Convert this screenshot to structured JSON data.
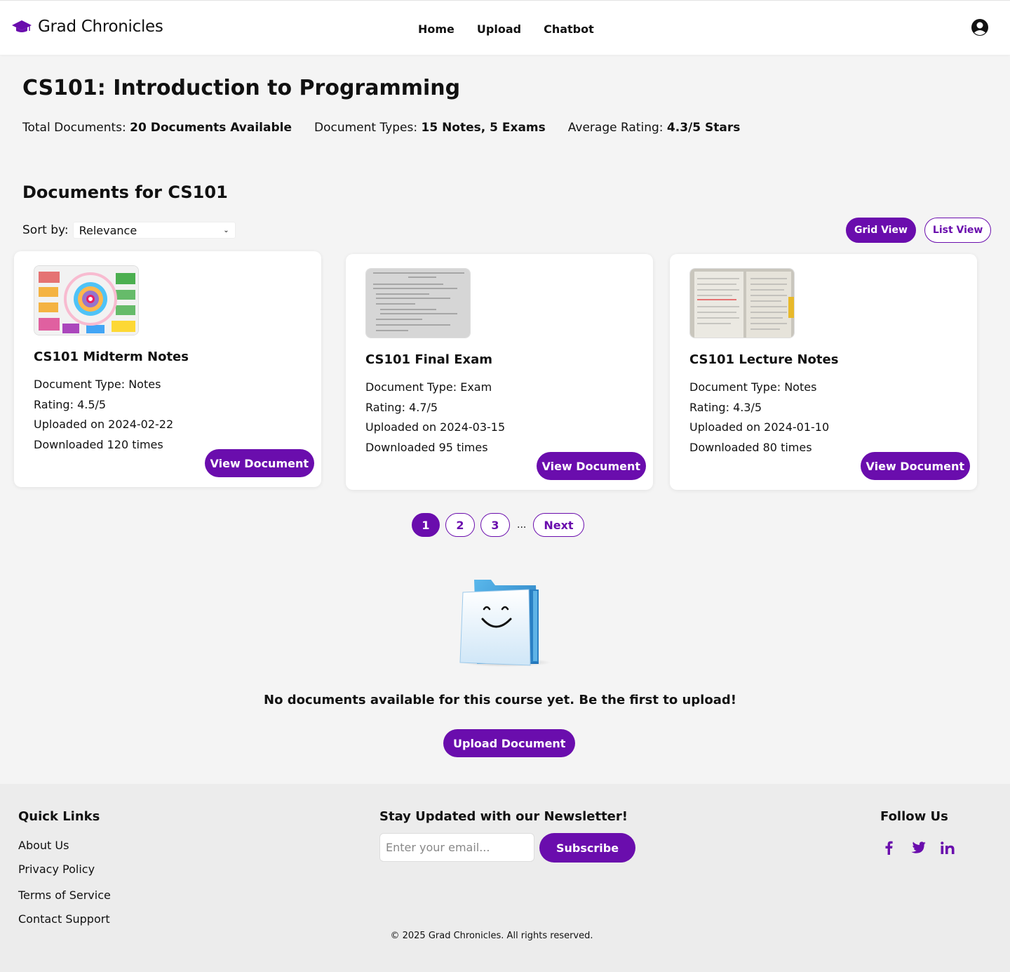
{
  "header": {
    "brand": "Grad Chronicles",
    "brand_icon": "graduation-cap-icon",
    "nav": [
      "Home",
      "Upload",
      "Chatbot"
    ],
    "account_icon": "user-circle-icon"
  },
  "course": {
    "title": "CS101: Introduction to Programming",
    "stats": [
      {
        "label": "Total Documents: ",
        "value": "20 Documents Available"
      },
      {
        "label": "Document Types: ",
        "value": "15 Notes, 5 Exams"
      },
      {
        "label": "Average Rating: ",
        "value": "4.3/5 Stars"
      }
    ]
  },
  "documents": {
    "heading": "Documents for CS101",
    "sort_label": "Sort by:",
    "sort_value": "Relevance",
    "grid_view_label": "Grid View",
    "list_view_label": "List View",
    "cards": [
      {
        "title": "CS101 Midterm Notes",
        "type": "Document Type: Notes",
        "rating": "Rating: 4.5/5",
        "uploaded": "Uploaded on 2024-02-22",
        "downloads": "Downloaded 120 times",
        "button": "View Document"
      },
      {
        "title": "CS101 Final Exam",
        "type": "Document Type: Exam",
        "rating": "Rating: 4.7/5",
        "uploaded": "Uploaded on 2024-03-15",
        "downloads": "Downloaded 95 times",
        "button": "View Document"
      },
      {
        "title": "CS101 Lecture Notes",
        "type": "Document Type: Notes",
        "rating": "Rating: 4.3/5",
        "uploaded": "Uploaded on 2024-01-10",
        "downloads": "Downloaded 80 times",
        "button": "View Document"
      }
    ]
  },
  "pagination": {
    "pages": [
      "1",
      "2",
      "3"
    ],
    "ellipsis": "...",
    "next": "Next",
    "active": "1"
  },
  "empty_state": {
    "message": "No documents available for this course yet. Be the first to upload!",
    "button": "Upload Document"
  },
  "footer": {
    "quick_links_title": "Quick Links",
    "quick_links": [
      "About Us",
      "Privacy Policy",
      "Terms of Service",
      "Contact Support"
    ],
    "newsletter_title": "Stay Updated with our Newsletter!",
    "email_placeholder": "Enter your email...",
    "subscribe_label": "Subscribe",
    "follow_title": "Follow Us",
    "social_icons": [
      "facebook-icon",
      "twitter-icon",
      "linkedin-icon"
    ],
    "copyright": "© 2025 Grad Chronicles. All rights reserved."
  },
  "colors": {
    "accent": "#6a0dad",
    "background": "#f4f4f4",
    "footer_bg": "#ececec"
  }
}
